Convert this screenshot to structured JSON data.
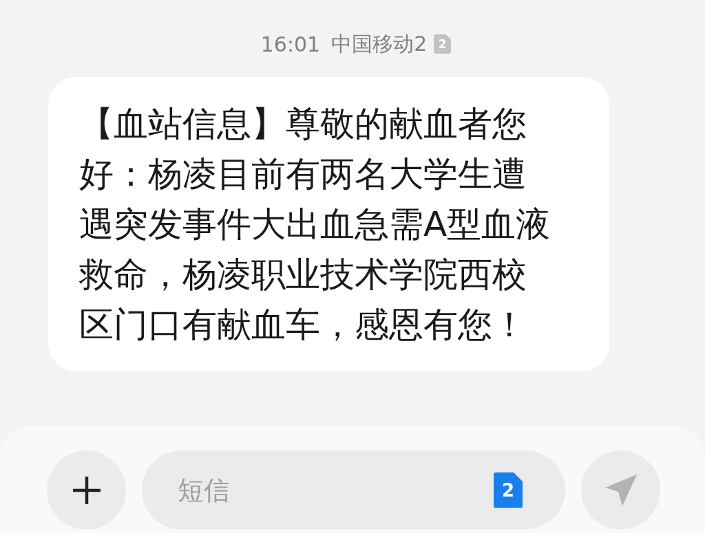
{
  "status_line": {
    "time": "16:01",
    "carrier": "中国移动2",
    "sim": "2"
  },
  "message": {
    "text": "【血站信息】尊敬的献血者您好：杨凌目前有两名大学生遭遇突发事件大出血急需A型血液救命，杨凌职业技术学院西校区门口有献血车，感恩有您！"
  },
  "composer": {
    "placeholder": "短信",
    "sim": "2"
  }
}
